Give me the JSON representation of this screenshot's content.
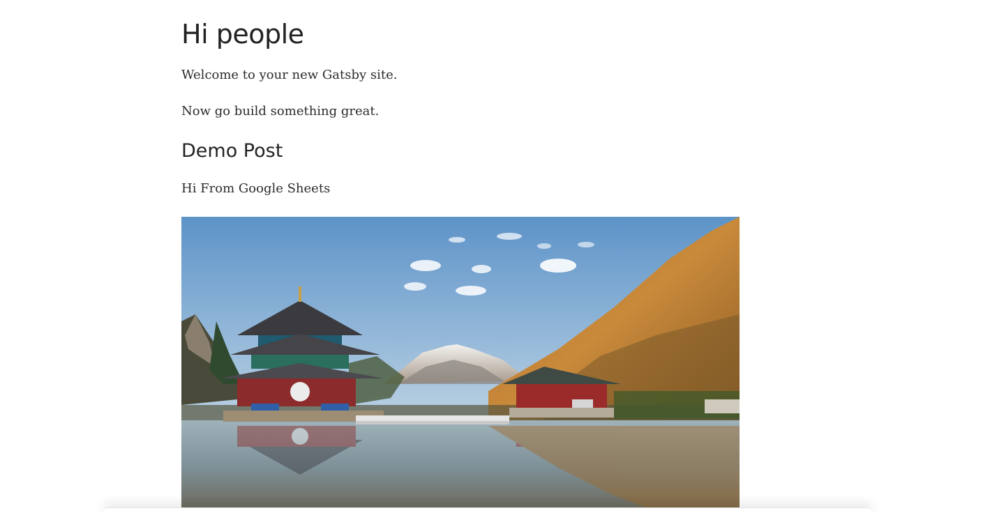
{
  "site": {
    "title": "Hi people",
    "intro": [
      "Welcome to your new Gatsby site.",
      "Now go build something great."
    ]
  },
  "post": {
    "title": "Demo Post",
    "body": "Hi From Google Sheets"
  }
}
